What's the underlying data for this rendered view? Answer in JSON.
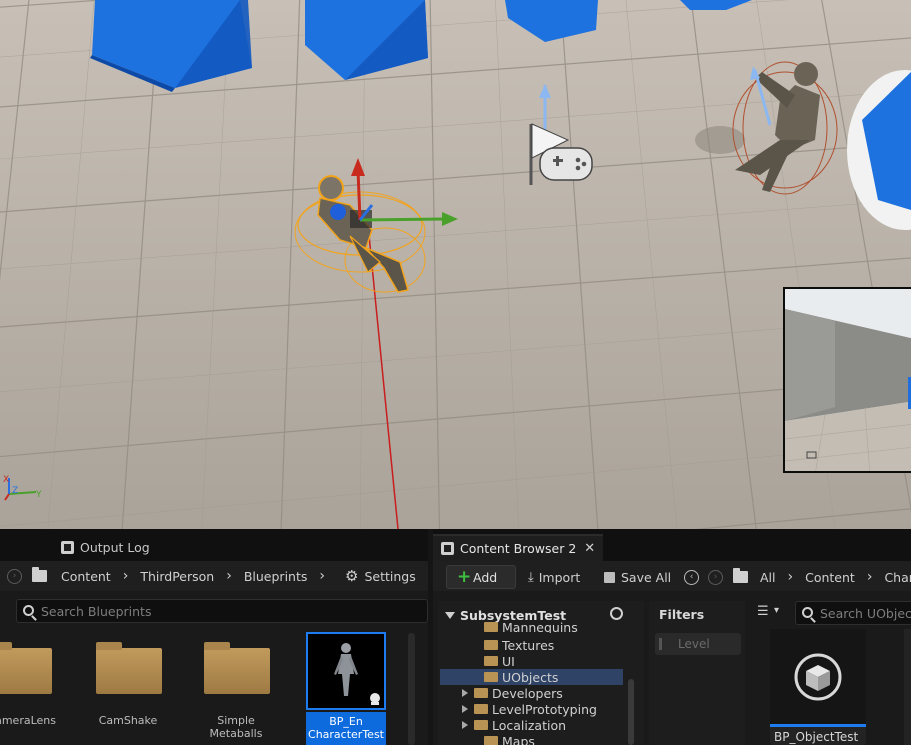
{
  "viewport": {
    "axis_labels": {
      "x": "X",
      "y": "Y",
      "z": "Z"
    }
  },
  "left_panel": {
    "tab_label": "Output Log",
    "breadcrumbs": [
      "Content",
      "ThirdPerson",
      "Blueprints"
    ],
    "settings_label": "Settings",
    "search_placeholder": "Search Blueprints",
    "assets": [
      {
        "label": "ameraLens",
        "kind": "folder"
      },
      {
        "label": "CamShake",
        "kind": "folder"
      },
      {
        "label": "Simple Metaballs",
        "kind": "folder"
      },
      {
        "label": "BP_En CharacterTest",
        "kind": "blueprint",
        "selected": true
      }
    ]
  },
  "right_panel": {
    "tab_label": "Content Browser 2",
    "add_label": "Add",
    "import_label": "Import",
    "save_all_label": "Save All",
    "breadcrumbs": [
      "All",
      "Content",
      "Char"
    ],
    "tree_header": "SubsystemTest",
    "tree_items": [
      {
        "label": "Mannequins",
        "expandable": false,
        "selected": false
      },
      {
        "label": "Textures",
        "expandable": false,
        "selected": false
      },
      {
        "label": "UI",
        "expandable": false,
        "selected": false
      },
      {
        "label": "UObjects",
        "expandable": false,
        "selected": true
      },
      {
        "label": "Developers",
        "expandable": true,
        "selected": false
      },
      {
        "label": "LevelPrototyping",
        "expandable": true,
        "selected": false
      },
      {
        "label": "Localization",
        "expandable": true,
        "selected": false
      },
      {
        "label": "Maps",
        "expandable": false,
        "selected": false
      }
    ],
    "filters_title": "Filters",
    "filter_chip": "Level",
    "search_placeholder": "Search UObjects",
    "asset_label": "BP_ObjectTest"
  },
  "colors": {
    "accent": "#1d7df0",
    "selection_outline": "#f2a31c",
    "cube": "#1467d6"
  }
}
